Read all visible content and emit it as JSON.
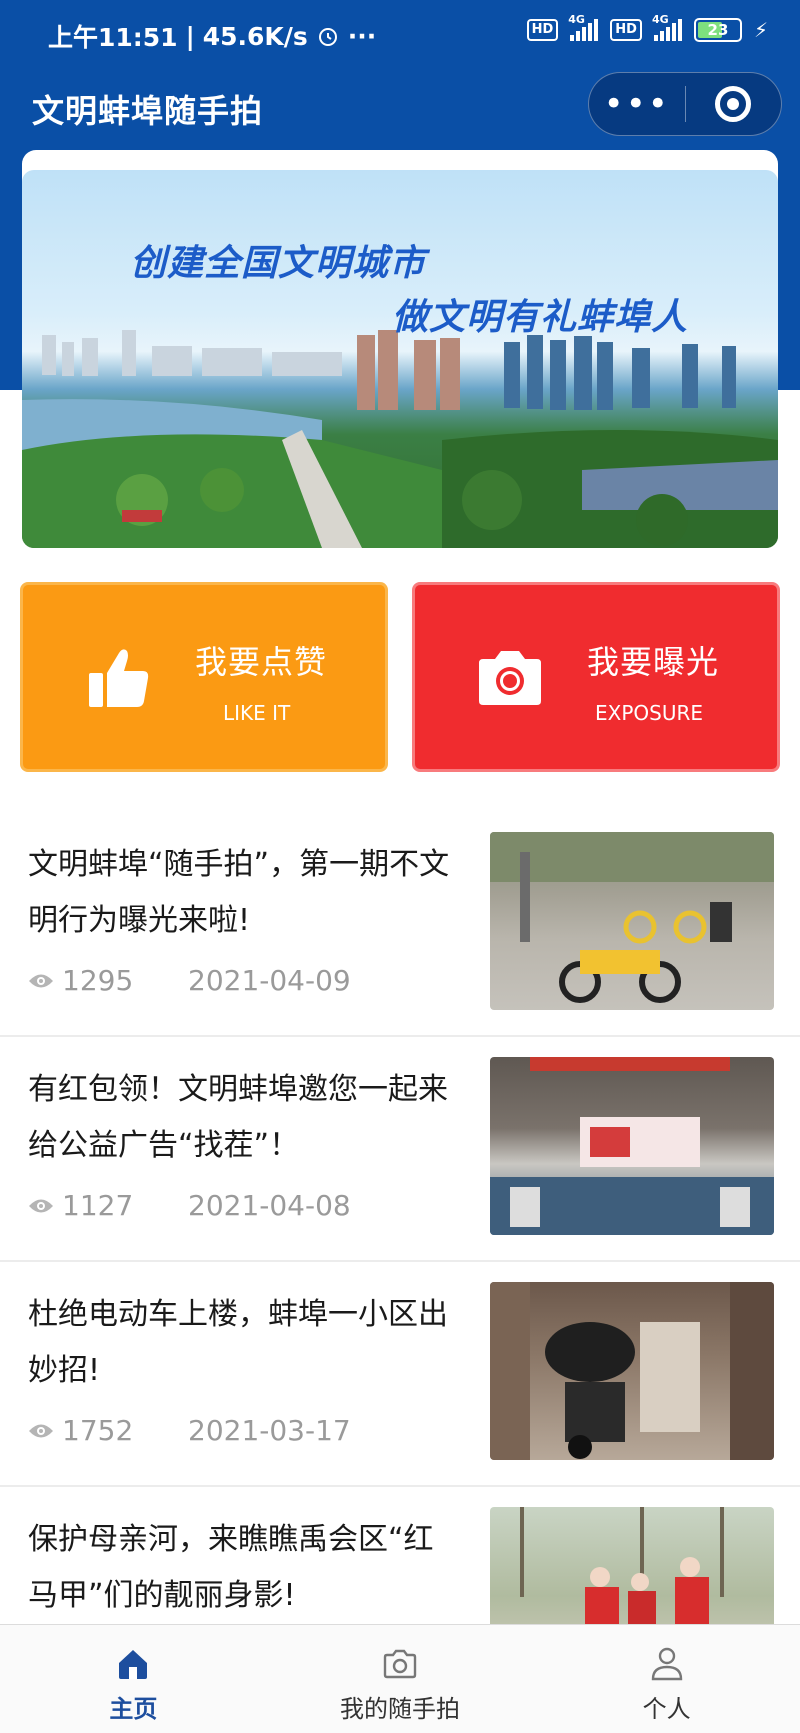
{
  "status_bar": {
    "time": "上午11:51",
    "speed": "45.6K/s",
    "icons": [
      "alarm-icon",
      "more-dots-icon",
      "hd-icon",
      "signal-4g-icon",
      "hd-icon",
      "signal-4g-icon",
      "battery-icon",
      "charging-icon"
    ],
    "hd": "HD",
    "net": "4G",
    "battery": "23"
  },
  "nav": {
    "title": "文明蚌埠随手拍",
    "more": "•••"
  },
  "banner": {
    "line1": "创建全国文明城市",
    "line2": "做文明有礼蚌埠人"
  },
  "actions": {
    "like": {
      "cn": "我要点赞",
      "en": "LIKE IT",
      "icon": "thumbs-up-icon"
    },
    "expose": {
      "cn": "我要曝光",
      "en": "EXPOSURE",
      "icon": "camera-icon"
    }
  },
  "articles": [
    {
      "title": "文明蚌埠“随手拍”，第一期不文明行为曝光来啦!",
      "views": "1295",
      "date": "2021-04-09"
    },
    {
      "title": "有红包领！文明蚌埠邀您一起来给公益广告“找茬”！",
      "views": "1127",
      "date": "2021-04-08"
    },
    {
      "title": "杜绝电动车上楼，蚌埠一小区出妙招!",
      "views": "1752",
      "date": "2021-03-17"
    },
    {
      "title": "保护母亲河，来瞧瞧禹会区“红马甲”们的靓丽身影!",
      "views": "",
      "date": ""
    }
  ],
  "tabs": [
    {
      "label": "主页",
      "icon": "home-icon"
    },
    {
      "label": "我的随手拍",
      "icon": "camera-icon"
    },
    {
      "label": "个人",
      "icon": "person-icon"
    }
  ],
  "colors": {
    "brand": "#0a4fa6",
    "like": "#fb9a13",
    "expose": "#f02c2f",
    "tab_active": "#1d4e9e"
  }
}
